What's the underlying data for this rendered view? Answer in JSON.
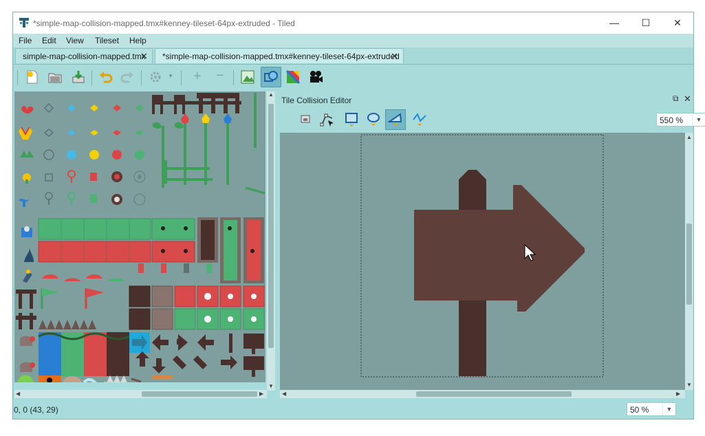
{
  "window": {
    "title": "*simple-map-collision-mapped.tmx#kenney-tileset-64px-extruded - Tiled",
    "controls": {
      "minimize": "—",
      "maximize": "☐",
      "close": "✕"
    }
  },
  "menu": [
    "File",
    "Edit",
    "View",
    "Tileset",
    "Help"
  ],
  "tabs": [
    {
      "label": "simple-map-collision-mapped.tmx",
      "active": false
    },
    {
      "label": "*simple-map-collision-mapped.tmx#kenney-tileset-64px-extruded",
      "active": true
    }
  ],
  "toolbar": {
    "icons": [
      "new-file-icon",
      "open-file-icon",
      "export-icon",
      "undo-icon",
      "redo-icon",
      "stamp-settings-icon",
      "add-icon",
      "remove-icon",
      "tileset-image-icon",
      "collision-editor-icon",
      "terrain-icon",
      "animation-icon"
    ]
  },
  "collision_editor": {
    "title": "Tile Collision Editor",
    "tools": [
      "select-objects-icon",
      "edit-polygons-icon",
      "rectangle-icon",
      "ellipse-icon",
      "polygon-icon",
      "polyline-icon"
    ],
    "zoom": "550 %"
  },
  "status": {
    "coords": "0, 0 (43, 29)",
    "zoom": "50 %"
  },
  "colors": {
    "window_bg": "#a8dcdc",
    "canvas_bg": "#7f9e9e",
    "sign_wood": "#5e3f3a",
    "sign_post": "#4a302c",
    "accent_red": "#d94a4a",
    "accent_green": "#4db374"
  }
}
